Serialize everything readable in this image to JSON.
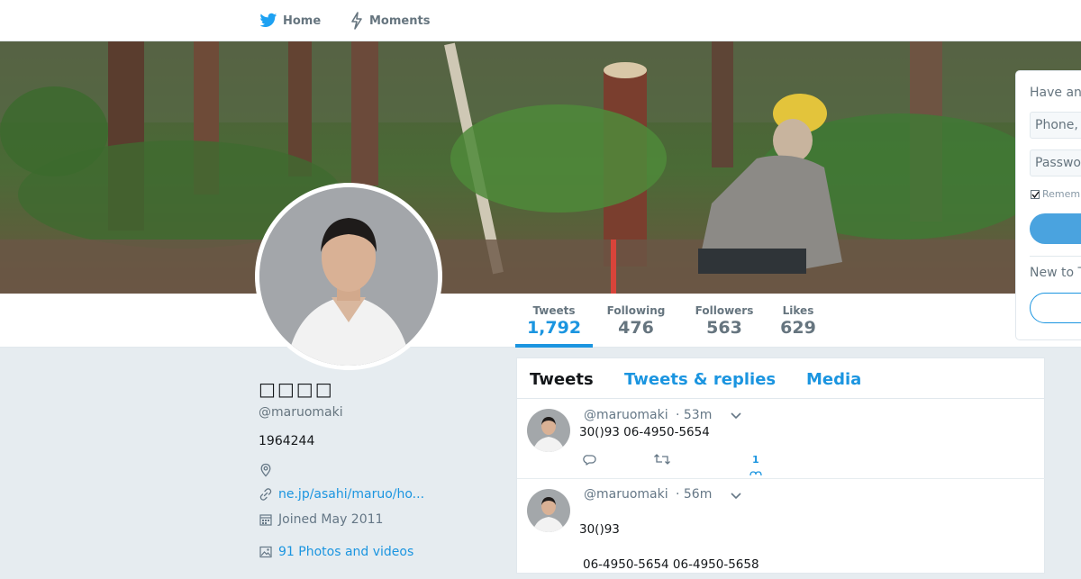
{
  "nav": {
    "home": "Home",
    "moments": "Moments"
  },
  "profile": {
    "name": "□□□□",
    "handle": "@maruomaki",
    "bio": "1964244",
    "url": "ne.jp/asahi/maruo/ho...",
    "joined": "Joined May 2011",
    "photos": "91 Photos and videos"
  },
  "stats": [
    {
      "label": "Tweets",
      "value": "1,792"
    },
    {
      "label": "Following",
      "value": "476"
    },
    {
      "label": "Followers",
      "value": "563"
    },
    {
      "label": "Likes",
      "value": "629"
    }
  ],
  "tabs": [
    "Tweets",
    "Tweets & replies",
    "Media"
  ],
  "tweets": [
    {
      "handle": "@maruomaki",
      "time": "· 53m",
      "text": "30()93 06-4950-5654",
      "like_count": "1"
    },
    {
      "handle": "@maruomaki",
      "time": "· 56m",
      "text": "30()93",
      "text2": "06-4950-5654 06-4950-5658"
    }
  ],
  "login": {
    "title": "Have an",
    "phone_placeholder": "Phone,",
    "password_placeholder": "Passwo",
    "remember": "Remem",
    "new_to": "New to T"
  },
  "colors": {
    "accent": "#1b95e0",
    "background": "#e6ecf0"
  }
}
